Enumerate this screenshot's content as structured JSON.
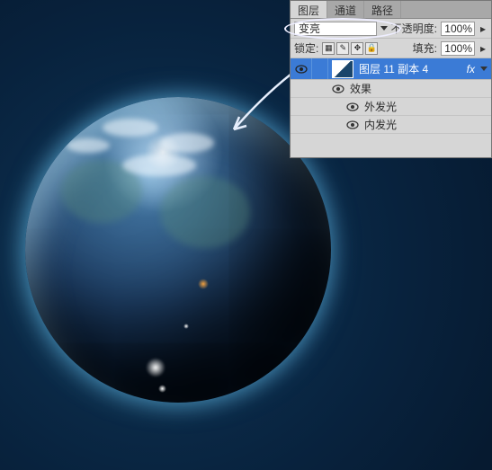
{
  "panel": {
    "tabs": [
      "图层",
      "通道",
      "路径"
    ],
    "blend_mode": "变亮",
    "opacity_label": "不透明度:",
    "opacity_value": "100%",
    "lock_label": "锁定:",
    "fill_label": "填充:",
    "fill_value": "100%",
    "layer": {
      "name": "图层 11 副本 4",
      "fx_badge": "fx",
      "effects_label": "效果",
      "effects": [
        "外发光",
        "内发光"
      ]
    }
  },
  "icons": {
    "eye": "●",
    "dropdown": "▾",
    "chev": "▸",
    "lock_pixels": "▦",
    "lock_brush": "✎",
    "lock_move": "✥",
    "lock_all": "🔒"
  }
}
